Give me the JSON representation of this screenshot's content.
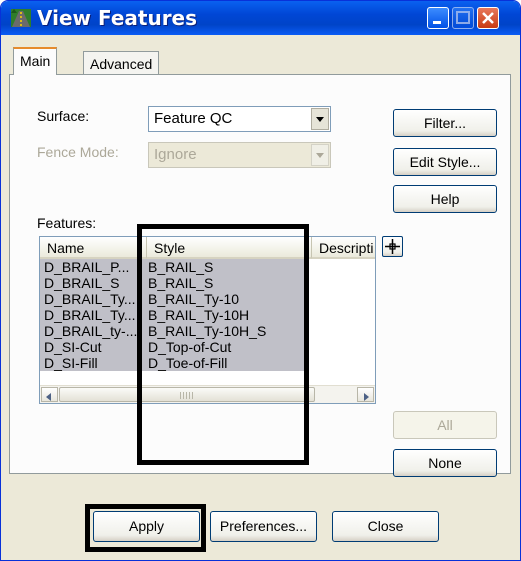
{
  "window": {
    "title": "View Features",
    "title_icon": "road-icon"
  },
  "title_buttons": {
    "minimize": "minimize-icon",
    "maximize": "maximize-icon",
    "close": "close-icon"
  },
  "tabs": [
    {
      "label": "Main",
      "selected": true
    },
    {
      "label": "Advanced",
      "selected": false
    }
  ],
  "form": {
    "surface_label": "Surface:",
    "surface_value": "Feature QC",
    "fence_label": "Fence Mode:",
    "fence_value": "Ignore",
    "features_label": "Features:"
  },
  "side_buttons": {
    "filter": "Filter...",
    "edit_style": "Edit Style...",
    "help": "Help",
    "all": "All",
    "none": "None"
  },
  "list": {
    "columns": [
      "Name",
      "Style",
      "Descripti"
    ],
    "rows": [
      {
        "name": "D_BRAIL_P...",
        "style": "B_RAIL_S"
      },
      {
        "name": "D_BRAIL_S",
        "style": "B_RAIL_S"
      },
      {
        "name": "D_BRAIL_Ty...",
        "style": "B_RAIL_Ty-10"
      },
      {
        "name": "D_BRAIL_Ty...",
        "style": "B_RAIL_Ty-10H"
      },
      {
        "name": "D_BRAIL_ty-...",
        "style": "B_RAIL_Ty-10H_S"
      },
      {
        "name": "D_SI-Cut",
        "style": "D_Top-of-Cut"
      },
      {
        "name": "D_SI-Fill",
        "style": "D_Toe-of-Fill"
      }
    ],
    "pin_icon": "target-icon"
  },
  "footer": {
    "apply": "Apply",
    "preferences": "Preferences...",
    "close": "Close"
  },
  "colors": {
    "title_bar": "#0054e3",
    "selection": "#c0c0c8",
    "highlight_box": "#000000",
    "dialog_bg": "#ece9d8"
  }
}
